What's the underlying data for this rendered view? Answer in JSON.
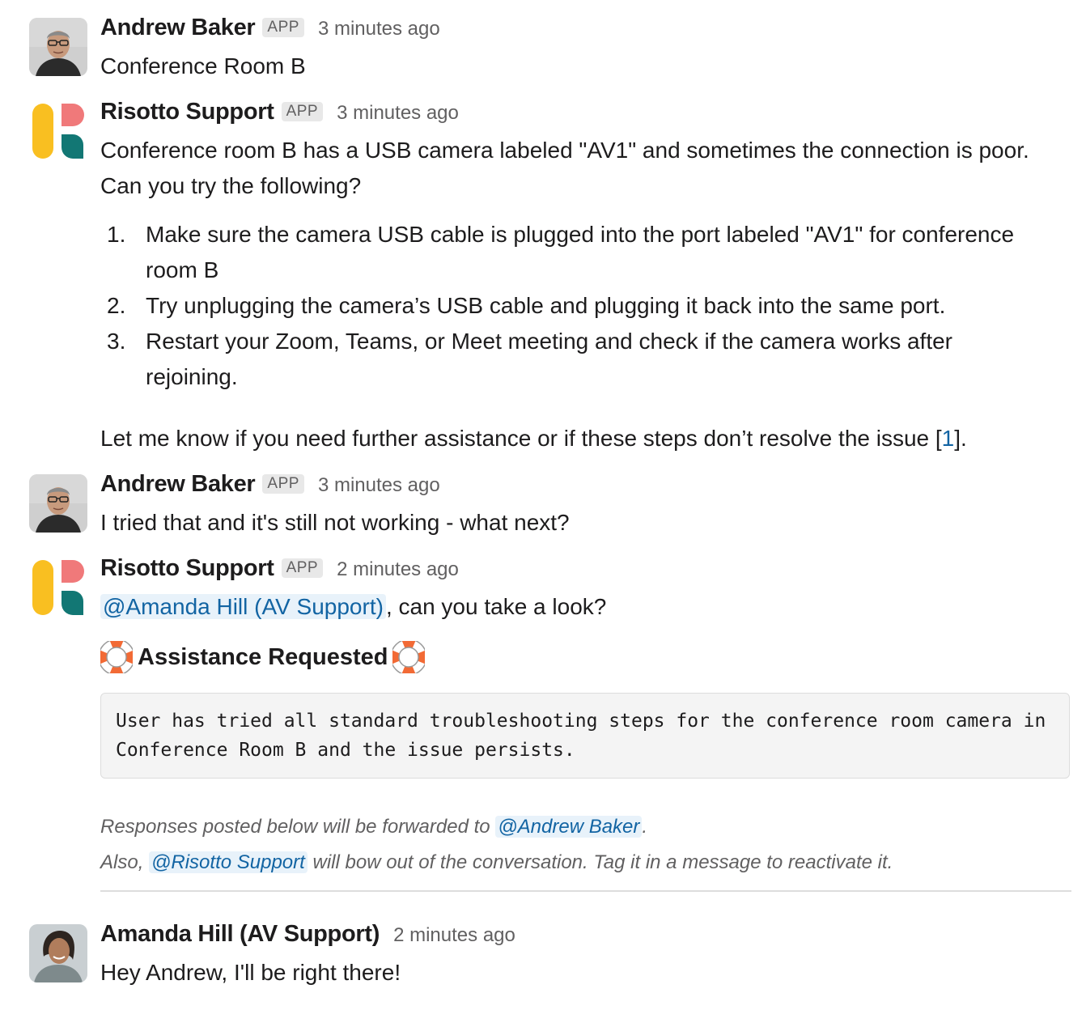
{
  "messages": {
    "m1": {
      "sender": "Andrew Baker",
      "badge": "APP",
      "time": "3 minutes ago",
      "text": "Conference Room B"
    },
    "m2": {
      "sender": "Risotto Support",
      "badge": "APP",
      "time": "3 minutes ago",
      "line1": "Conference room B has a USB camera labeled \"AV1\" and sometimes the connection is poor.",
      "line2": "Can you try the following?",
      "steps": [
        {
          "num": "1.",
          "text": "Make sure the camera USB cable is plugged into the port labeled \"AV1\" for conference room B"
        },
        {
          "num": "2.",
          "text": "Try unplugging the camera’s USB cable and plugging it back into the same port."
        },
        {
          "num": "3.",
          "text": "Restart your Zoom, Teams, or Meet meeting and check if the camera works after rejoining."
        }
      ],
      "closing_before": "Let me know if you need further assistance or if these steps don’t resolve the issue [",
      "closing_ref": "1",
      "closing_after": "]."
    },
    "m3": {
      "sender": "Andrew Baker",
      "badge": "APP",
      "time": "3 minutes ago",
      "text": "I tried that and it's still not working - what next?"
    },
    "m4": {
      "sender": "Risotto Support",
      "badge": "APP",
      "time": "2 minutes ago",
      "mention": "@Amanda Hill (AV Support)",
      "after_mention": ", can you take a look?",
      "heading": "Assistance Requested",
      "code_text": "User has tried all standard troubleshooting steps for the conference room camera in Conference Room B and the issue persists.",
      "note1_before": "Responses posted below will be forwarded to ",
      "note1_mention": "@Andrew Baker",
      "note1_after": ".",
      "note2_before": "Also, ",
      "note2_mention": "@Risotto Support",
      "note2_after": " will bow out of the conversation. Tag it in a message to reactivate it."
    },
    "m5": {
      "sender": "Amanda Hill (AV Support)",
      "time": "2 minutes ago",
      "text": "Hey Andrew, I'll be right there!"
    }
  },
  "colors": {
    "logo_yellow": "#f9bf21",
    "logo_pink": "#f0797a",
    "logo_teal": "#127774",
    "link": "#1264a3",
    "buoy_orange": "#f26a35"
  }
}
